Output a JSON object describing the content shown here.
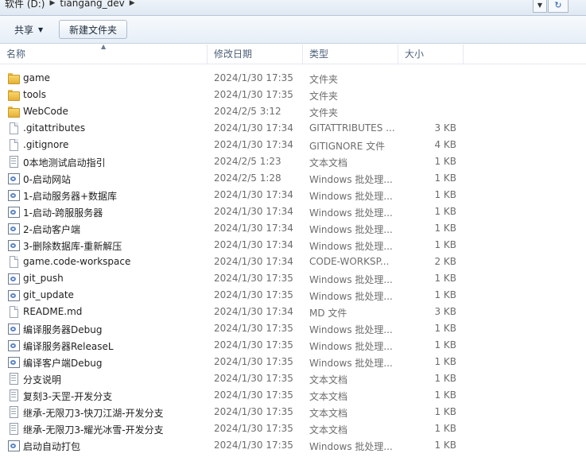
{
  "address": {
    "crumbs": [
      "软件 (D:)",
      "tiangang_dev"
    ]
  },
  "toolbar": {
    "share_label": "共享",
    "new_folder_label": "新建文件夹"
  },
  "columns": {
    "name": "名称",
    "date": "修改日期",
    "type": "类型",
    "size": "大小"
  },
  "files": [
    {
      "name": "game",
      "date": "2024/1/30 17:35",
      "type": "文件夹",
      "size": "",
      "icon": "folder-icon"
    },
    {
      "name": "tools",
      "date": "2024/1/30 17:35",
      "type": "文件夹",
      "size": "",
      "icon": "folder-icon"
    },
    {
      "name": "WebCode",
      "date": "2024/2/5 3:12",
      "type": "文件夹",
      "size": "",
      "icon": "folder-icon"
    },
    {
      "name": ".gitattributes",
      "date": "2024/1/30 17:34",
      "type": "GITATTRIBUTES ...",
      "size": "3 KB",
      "icon": "file-icon"
    },
    {
      "name": ".gitignore",
      "date": "2024/1/30 17:34",
      "type": "GITIGNORE 文件",
      "size": "4 KB",
      "icon": "file-icon"
    },
    {
      "name": "0本地测试启动指引",
      "date": "2024/2/5 1:23",
      "type": "文本文档",
      "size": "1 KB",
      "icon": "text-file-icon"
    },
    {
      "name": "0-启动网站",
      "date": "2024/2/5 1:28",
      "type": "Windows 批处理...",
      "size": "1 KB",
      "icon": "batch-file-icon"
    },
    {
      "name": "1-启动服务器+数据库",
      "date": "2024/1/30 17:34",
      "type": "Windows 批处理...",
      "size": "1 KB",
      "icon": "batch-file-icon"
    },
    {
      "name": "1-启动-跨服服务器",
      "date": "2024/1/30 17:34",
      "type": "Windows 批处理...",
      "size": "1 KB",
      "icon": "batch-file-icon"
    },
    {
      "name": "2-启动客户端",
      "date": "2024/1/30 17:34",
      "type": "Windows 批处理...",
      "size": "1 KB",
      "icon": "batch-file-icon"
    },
    {
      "name": "3-删除数据库-重新解压",
      "date": "2024/1/30 17:34",
      "type": "Windows 批处理...",
      "size": "1 KB",
      "icon": "batch-file-icon"
    },
    {
      "name": "game.code-workspace",
      "date": "2024/1/30 17:34",
      "type": "CODE-WORKSP...",
      "size": "2 KB",
      "icon": "file-icon"
    },
    {
      "name": "git_push",
      "date": "2024/1/30 17:35",
      "type": "Windows 批处理...",
      "size": "1 KB",
      "icon": "batch-file-icon"
    },
    {
      "name": "git_update",
      "date": "2024/1/30 17:35",
      "type": "Windows 批处理...",
      "size": "1 KB",
      "icon": "batch-file-icon"
    },
    {
      "name": "README.md",
      "date": "2024/1/30 17:34",
      "type": "MD 文件",
      "size": "3 KB",
      "icon": "file-icon"
    },
    {
      "name": "编译服务器Debug",
      "date": "2024/1/30 17:35",
      "type": "Windows 批处理...",
      "size": "1 KB",
      "icon": "batch-file-icon"
    },
    {
      "name": "编译服务器ReleaseL",
      "date": "2024/1/30 17:35",
      "type": "Windows 批处理...",
      "size": "1 KB",
      "icon": "batch-file-icon"
    },
    {
      "name": "编译客户端Debug",
      "date": "2024/1/30 17:35",
      "type": "Windows 批处理...",
      "size": "1 KB",
      "icon": "batch-file-icon"
    },
    {
      "name": "分支说明",
      "date": "2024/1/30 17:35",
      "type": "文本文档",
      "size": "1 KB",
      "icon": "text-file-icon"
    },
    {
      "name": "复刻3-天罡-开发分支",
      "date": "2024/1/30 17:35",
      "type": "文本文档",
      "size": "1 KB",
      "icon": "text-file-icon"
    },
    {
      "name": "继承-无限刀3-快刀江湖-开发分支",
      "date": "2024/1/30 17:35",
      "type": "文本文档",
      "size": "1 KB",
      "icon": "text-file-icon"
    },
    {
      "name": "继承-无限刀3-耀光冰雪-开发分支",
      "date": "2024/1/30 17:35",
      "type": "文本文档",
      "size": "1 KB",
      "icon": "text-file-icon"
    },
    {
      "name": "启动自动打包",
      "date": "2024/1/30 17:35",
      "type": "Windows 批处理...",
      "size": "1 KB",
      "icon": "batch-file-icon"
    }
  ]
}
